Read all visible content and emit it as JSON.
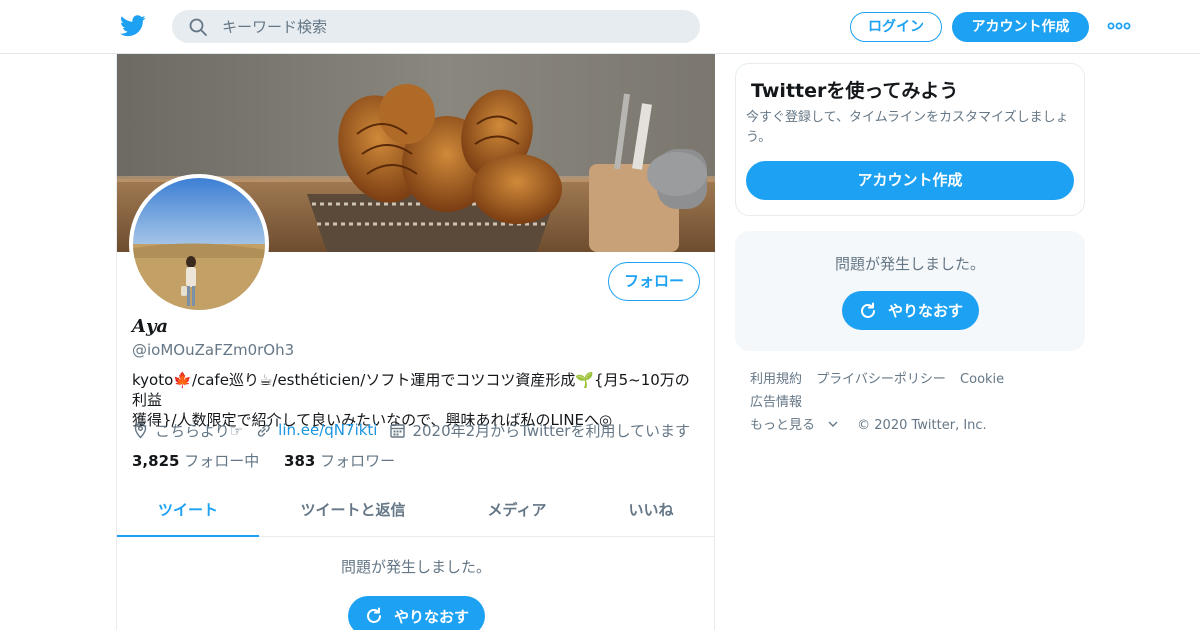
{
  "header": {
    "search_placeholder": "キーワード検索",
    "login_label": "ログイン",
    "signup_label": "アカウント作成"
  },
  "profile": {
    "name": "𝑨𝒚𝒂",
    "handle": "@ioMOuZaFZm0rOh3",
    "follow_label": "フォロー",
    "bio_line1": "kyoto🍁/cafe巡り☕/esthéticien/ソフト運用でコツコツ資産形成🌱{月5~10万の利益",
    "bio_line2": "獲得}/人数限定で紹介して良いみたいなので、興味あれば私のLINEへ◎",
    "location": "こちらより☞",
    "link": "lin.ee/qN7ikti",
    "joined": "2020年2月からTwitterを利用しています",
    "following_count": "3,825",
    "following_label": "フォロー中",
    "followers_count": "383",
    "followers_label": "フォロワー"
  },
  "tabs": [
    {
      "label": "ツイート",
      "active": true
    },
    {
      "label": "ツイートと返信",
      "active": false
    },
    {
      "label": "メディア",
      "active": false
    },
    {
      "label": "いいね",
      "active": false
    }
  ],
  "main": {
    "error_text": "問題が発生しました。",
    "retry_label": "やりなおす"
  },
  "sidebar": {
    "card_title": "Twitterを使ってみよう",
    "card_subtitle": "今すぐ登録して、タイムラインをカスタマイズしましょう。",
    "card_button": "アカウント作成",
    "error_text": "問題が発生しました。",
    "retry_label": "やりなおす"
  },
  "footer": {
    "terms": "利用規約",
    "privacy": "プライバシーポリシー",
    "cookie": "Cookie",
    "ads": "広告情報",
    "more": "もっと見る",
    "copyright": "© 2020 Twitter, Inc."
  },
  "colors": {
    "accent": "#1da1f2",
    "secondary_text": "#657786",
    "border": "#e6ecf0"
  },
  "icons": [
    "twitter-bird-icon",
    "search-icon",
    "more-dots-icon",
    "location-icon",
    "link-icon",
    "calendar-icon",
    "refresh-icon",
    "chevron-down-icon"
  ]
}
